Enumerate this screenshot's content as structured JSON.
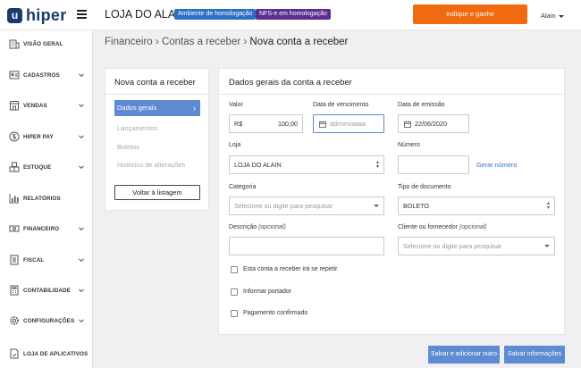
{
  "app": {
    "logo_mark": "u",
    "logo_text": "hiper"
  },
  "header": {
    "store_name": "LOJA DO ALAIN",
    "badge_homologacao": "Ambiente de homologação",
    "badge_nfse": "NFS-e em homologação",
    "indique_label": "Indique e ganhe",
    "user_name": "Alain"
  },
  "sidebar": {
    "items": [
      {
        "label": "VISÃO GERAL",
        "icon": "building-icon"
      },
      {
        "label": "CADASTROS",
        "icon": "id-card-icon"
      },
      {
        "label": "VENDAS",
        "icon": "store-icon"
      },
      {
        "label": "HIPER PAY",
        "icon": "dollar-icon"
      },
      {
        "label": "ESTOQUE",
        "icon": "boxes-icon"
      },
      {
        "label": "RELATÓRIOS",
        "icon": "bar-chart-icon"
      },
      {
        "label": "FINANCEIRO",
        "icon": "money-icon"
      },
      {
        "label": "FISCAL",
        "icon": "document-icon"
      },
      {
        "label": "CONTABILIDADE",
        "icon": "calculator-icon"
      },
      {
        "label": "CONFIGURAÇÕES",
        "icon": "gear-icon"
      },
      {
        "label": "LOJA DE APLICATIVOS",
        "icon": "app-store-icon"
      }
    ]
  },
  "breadcrumb": {
    "part1": "Financeiro",
    "part2": "Contas a receber",
    "current": "Nova conta a receber",
    "sep": "›"
  },
  "left_card": {
    "title": "Nova conta a receber",
    "active": "Dados gerais",
    "links": [
      "Lançamentos",
      "Boletos",
      "Histórico de alterações"
    ],
    "back_button": "Voltar à listagem"
  },
  "form": {
    "title": "Dados gerais da conta a receber",
    "valor_label": "Valor",
    "valor_prefix": "R$",
    "valor_value": "100,00",
    "vencimento_label": "Data de vencimento",
    "vencimento_placeholder": "dd/mm/aaaa",
    "emissao_label": "Data de emissão",
    "emissao_value": "22/06/2020",
    "loja_label": "Loja",
    "loja_value": "LOJA DO ALAIN",
    "numero_label": "Número",
    "numero_value": "",
    "gerar_numero": "Gerar número",
    "categoria_label": "Categoria",
    "categoria_placeholder": "Selecione ou digite para pesquisar",
    "tipo_label": "Tipo de documento",
    "tipo_value": "BOLETO",
    "descricao_label": "Descrição",
    "descricao_optional": "(opcional)",
    "cliente_label": "Cliente ou fornecedor",
    "cliente_optional": "(opcional)",
    "cliente_placeholder": "Selecione ou digite para pesquisar",
    "chk_repetir": "Esta conta a receber irá se repetir",
    "chk_portador": "Informar portador",
    "chk_pagamento": "Pagamento confirmado"
  },
  "footer": {
    "save_add": "Salvar e adicionar outro",
    "save": "Salvar informações"
  },
  "colors": {
    "accent_blue": "#5e8bd1",
    "orange": "#f06a0f",
    "badge_blue": "#2e6fc4",
    "badge_purple": "#5b2c91",
    "brand_navy": "#1a3b6e"
  }
}
